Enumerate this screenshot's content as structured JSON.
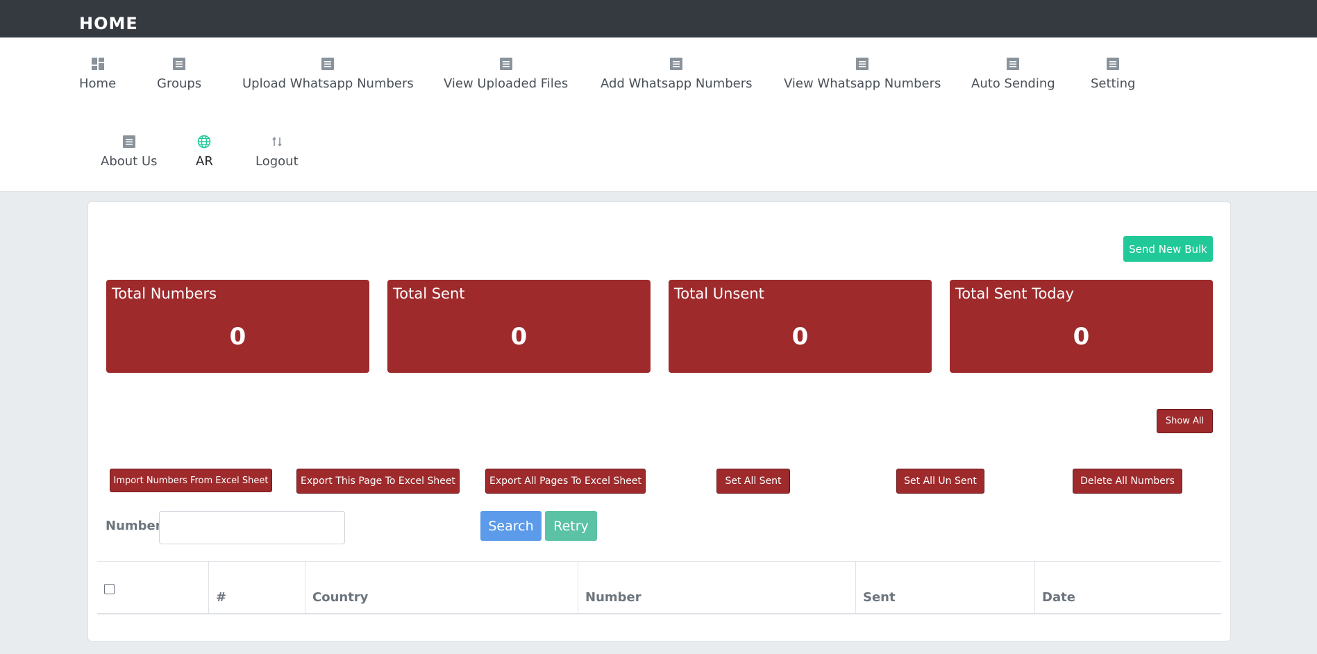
{
  "header": {
    "title": "HOME"
  },
  "nav": {
    "row1": [
      {
        "label": "Home",
        "icon": "dashboard-icon"
      },
      {
        "label": "Groups",
        "icon": "list-icon"
      },
      {
        "label": "Upload Whatsapp Numbers",
        "icon": "list-icon"
      },
      {
        "label": "View Uploaded Files",
        "icon": "list-icon"
      },
      {
        "label": "Add Whatsapp Numbers",
        "icon": "list-icon"
      },
      {
        "label": "View Whatsapp Numbers",
        "icon": "list-icon"
      },
      {
        "label": "Auto Sending",
        "icon": "list-icon"
      },
      {
        "label": "Setting",
        "icon": "list-icon"
      }
    ],
    "row2": [
      {
        "label": "About Us",
        "icon": "list-icon"
      },
      {
        "label": "AR",
        "icon": "globe-icon"
      },
      {
        "label": "Logout",
        "icon": "sort-arrows-icon"
      }
    ]
  },
  "actions": {
    "send_new_bulk": "Send New Bulk",
    "show_all": "Show All"
  },
  "stats": [
    {
      "label": "Total Numbers",
      "value": "0"
    },
    {
      "label": "Total Sent",
      "value": "0"
    },
    {
      "label": "Total Unsent",
      "value": "0"
    },
    {
      "label": "Total Sent Today",
      "value": "0"
    }
  ],
  "bulk_buttons": [
    "Import Numbers From Excel Sheet",
    "Export This Page To Excel Sheet",
    "Export All Pages To Excel Sheet",
    "Set All Sent",
    "Set All Un Sent",
    "Delete All Numbers"
  ],
  "search": {
    "label": "Number",
    "value": "",
    "search_button": "Search",
    "retry_button": "Retry"
  },
  "table": {
    "headers": [
      "#",
      "Country",
      "Number",
      "Sent",
      "Date"
    ]
  },
  "colors": {
    "topbar": "#343a40",
    "stat_card": "#9e2a2c",
    "send_bulk": "#20c997",
    "search": "#5b9bea",
    "retry": "#5bc2a5",
    "globe": "#20c997"
  }
}
